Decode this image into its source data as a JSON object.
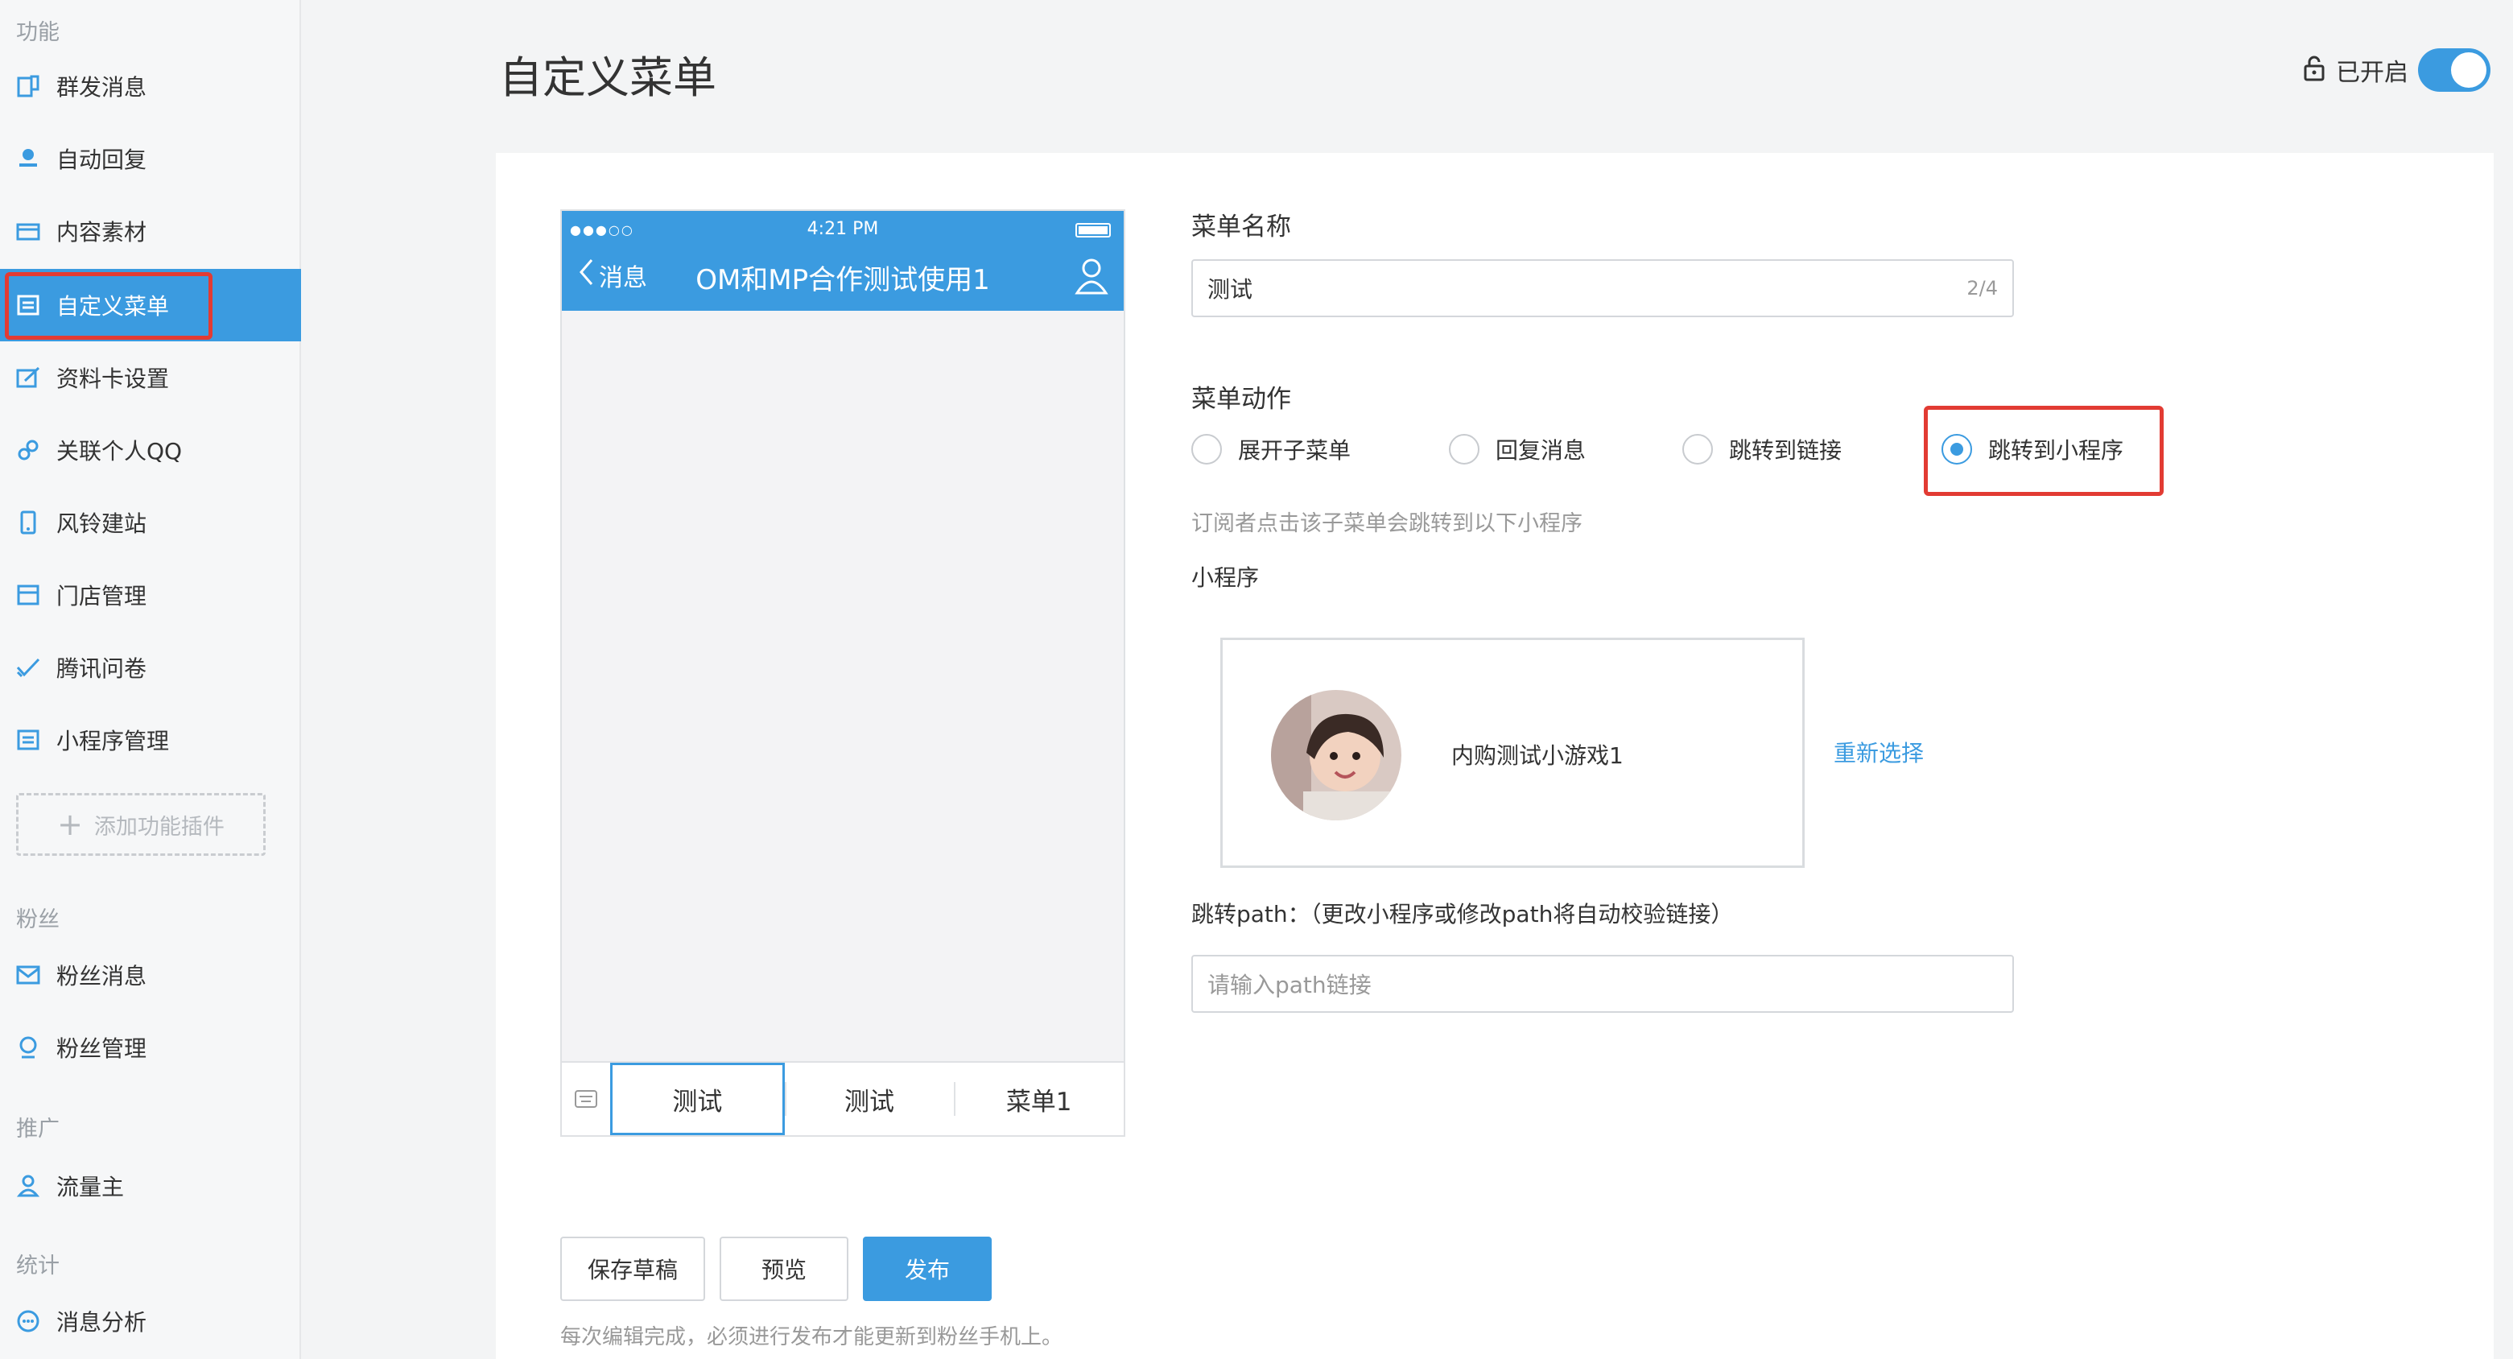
{
  "sidebar": {
    "sections": {
      "func": "功能",
      "fans": "粉丝",
      "promo": "推广",
      "stats": "统计"
    },
    "items": [
      {
        "label": "群发消息",
        "icon": "broadcast-icon"
      },
      {
        "label": "自动回复",
        "icon": "robot-icon"
      },
      {
        "label": "内容素材",
        "icon": "folder-icon"
      },
      {
        "label": "自定义菜单",
        "icon": "menu-doc-icon",
        "active": true
      },
      {
        "label": "资料卡设置",
        "icon": "edit-card-icon"
      },
      {
        "label": "关联个人QQ",
        "icon": "link-icon"
      },
      {
        "label": "风铃建站",
        "icon": "phone-icon"
      },
      {
        "label": "门店管理",
        "icon": "store-icon"
      },
      {
        "label": "腾讯问卷",
        "icon": "check-icon"
      },
      {
        "label": "小程序管理",
        "icon": "miniapp-icon"
      }
    ],
    "add_plugin": "添加功能插件",
    "fans_items": [
      {
        "label": "粉丝消息",
        "icon": "mail-icon"
      },
      {
        "label": "粉丝管理",
        "icon": "fans-icon"
      }
    ],
    "promo_items": [
      {
        "label": "流量主",
        "icon": "user-icon"
      }
    ],
    "stats_items": [
      {
        "label": "消息分析",
        "icon": "chat-icon"
      }
    ]
  },
  "header": {
    "title": "自定义菜单",
    "switch_label": "已开启",
    "switch_on": true
  },
  "phone": {
    "time": "4:21 PM",
    "back_label": "消息",
    "title": "OM和MP合作测试使用1",
    "menu_tabs": [
      "测试",
      "测试",
      "菜单1"
    ],
    "selected_tab": 0
  },
  "form": {
    "name_label": "菜单名称",
    "name_value": "测试",
    "name_counter": "2/4",
    "action_label": "菜单动作",
    "actions": [
      "展开子菜单",
      "回复消息",
      "跳转到链接",
      "跳转到小程序"
    ],
    "selected_action": 3,
    "action_hint": "订阅者点击该子菜单会跳转到以下小程序",
    "miniapp_label": "小程序",
    "miniapp_name": "内购测试小游戏1",
    "reselect": "重新选择",
    "path_label": "跳转path：（更改小程序或修改path将自动校验链接）",
    "path_placeholder": "请输入path链接"
  },
  "actions": {
    "save_draft": "保存草稿",
    "preview": "预览",
    "publish": "发布",
    "footnote": "每次编辑完成，必须进行发布才能更新到粉丝手机上。"
  },
  "colors": {
    "accent": "#3b9be0",
    "highlight": "#e23b33"
  }
}
